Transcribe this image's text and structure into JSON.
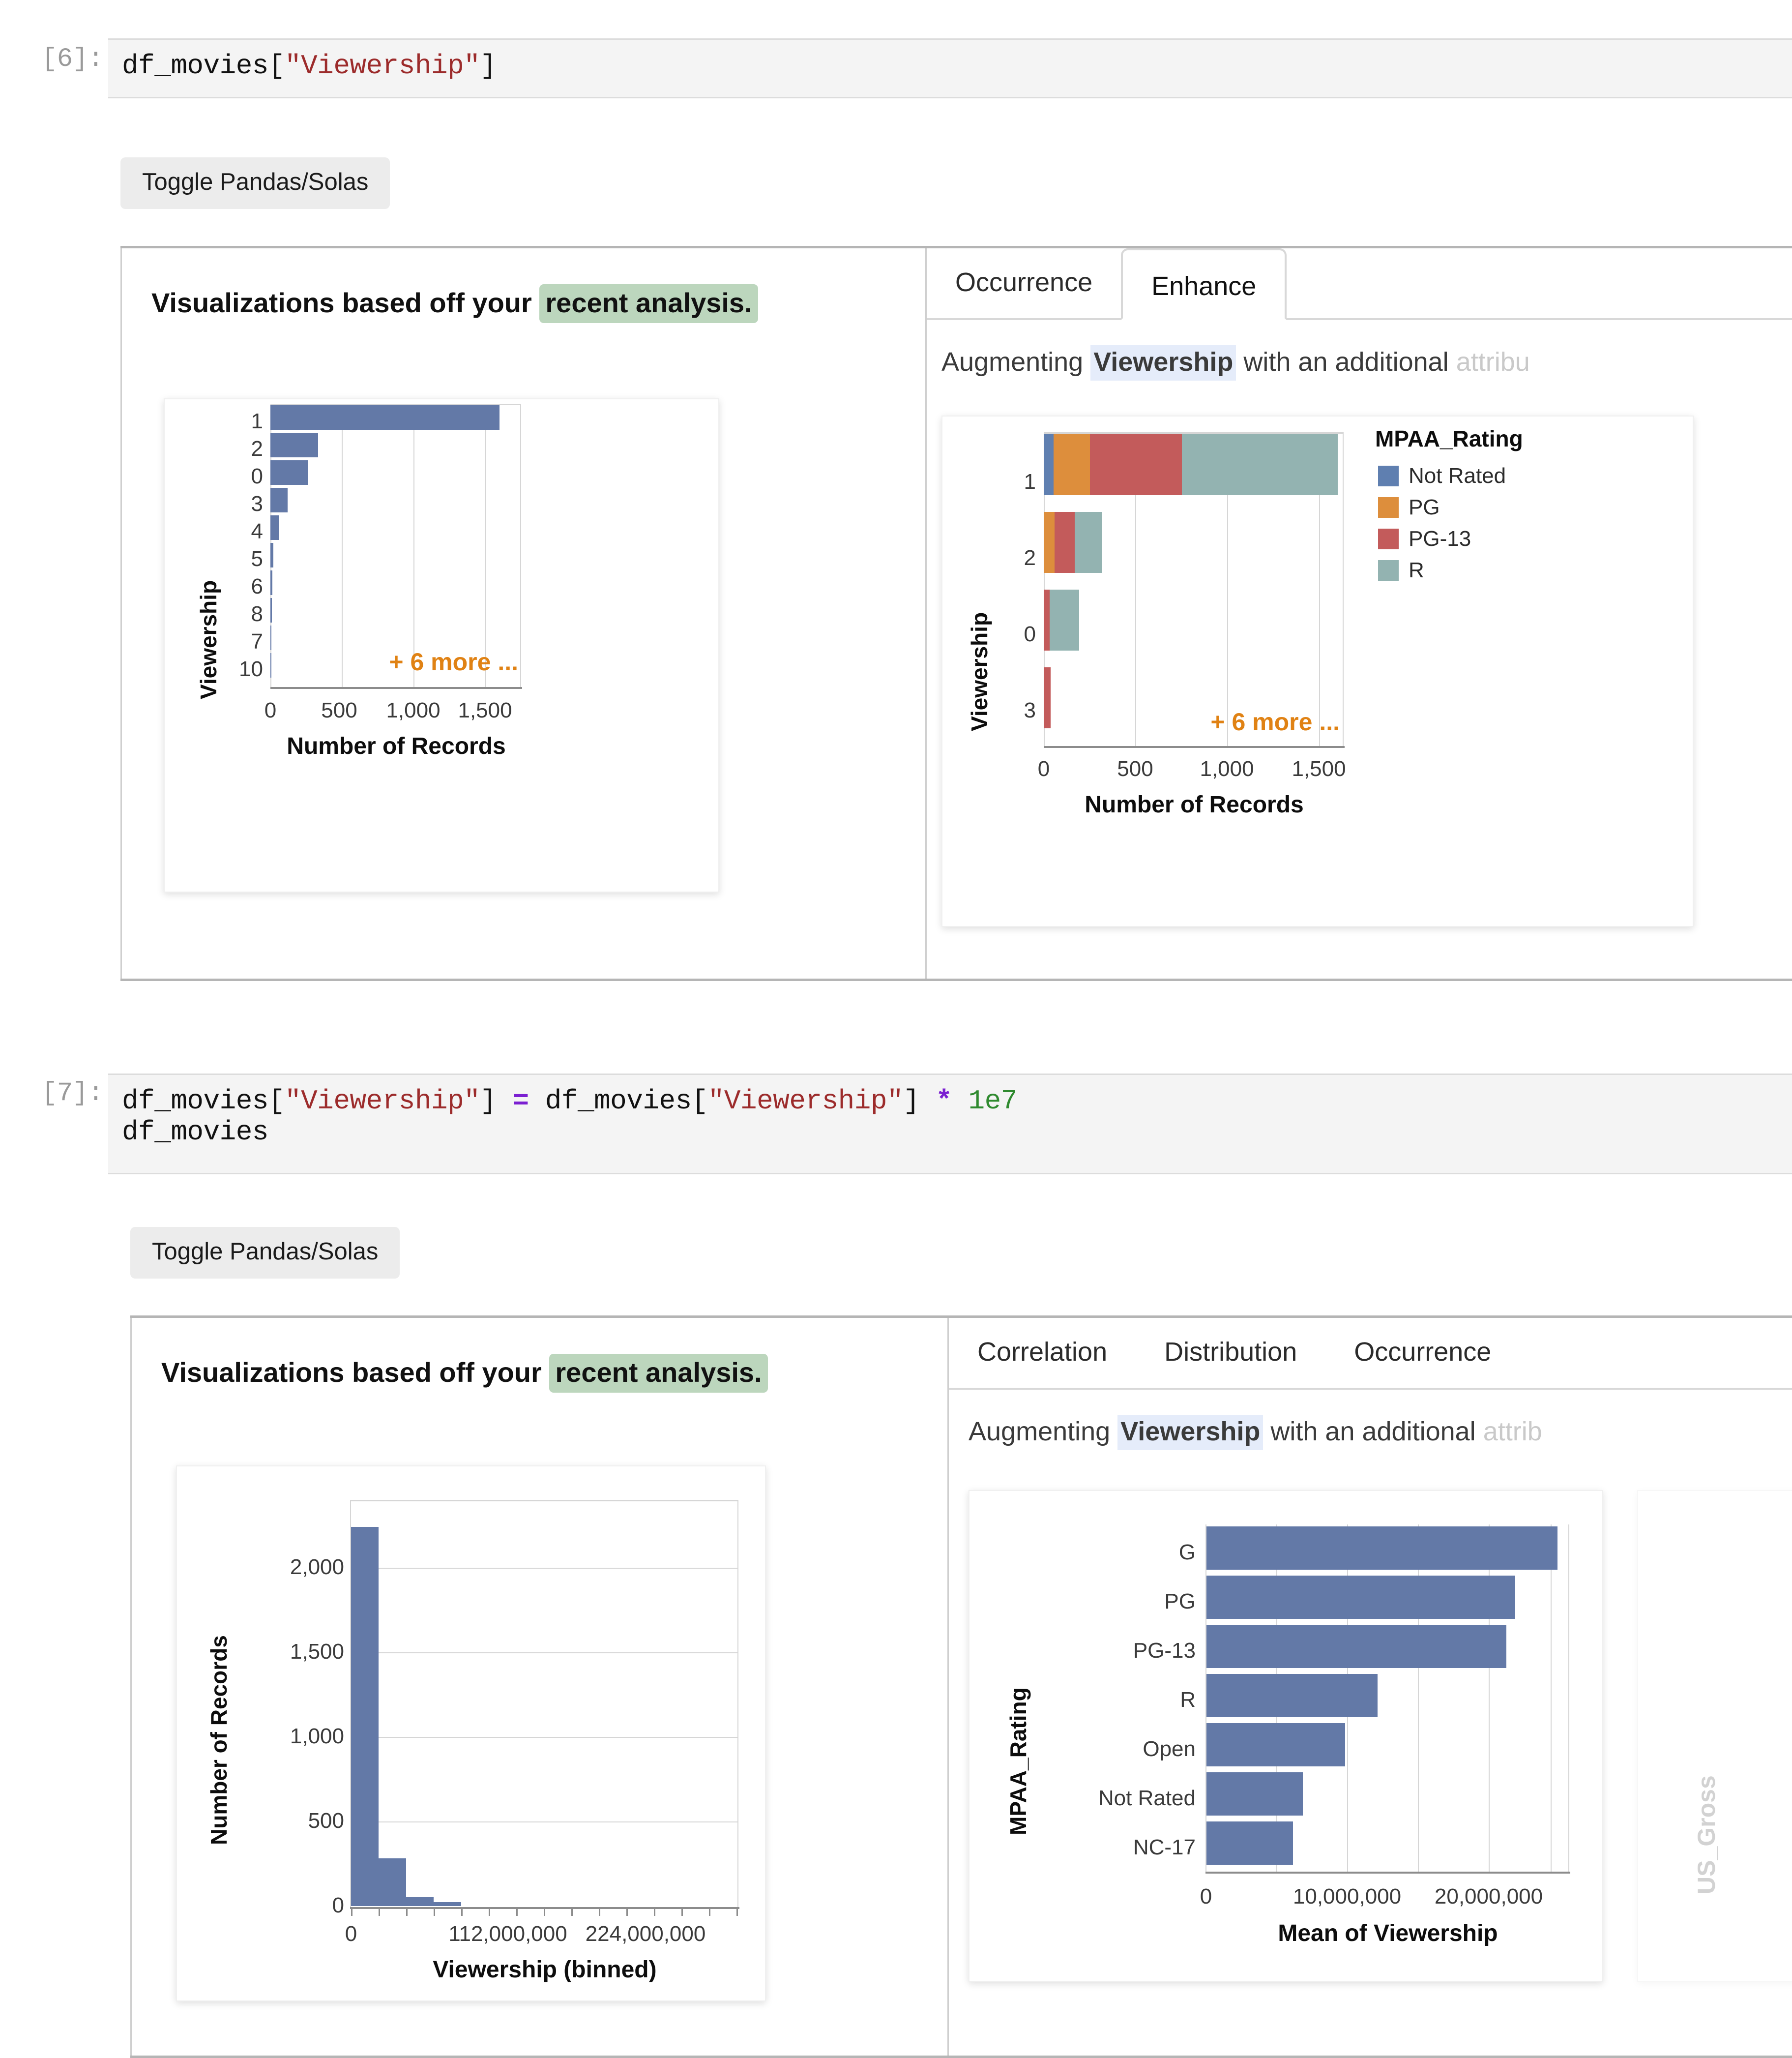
{
  "theme": {
    "bar_blue": "#6379a7",
    "legend_colors": [
      "#5f7fb0",
      "#dd8e3c",
      "#c35b5b",
      "#93b3b1"
    ],
    "accent_orange": "#e08214",
    "highlight_green": "#bcd6bd",
    "highlight_blue": "#e5ecfa",
    "code_bg": "#f4f4f4"
  },
  "cells": [
    {
      "prompt": "[6]:",
      "code_lines": [
        [
          {
            "t": "df_movies[",
            "c": "plain"
          },
          {
            "t": "\"Viewership\"",
            "c": "str"
          },
          {
            "t": "]",
            "c": "plain"
          }
        ]
      ],
      "toggle_label": "Toggle Pandas/Solas",
      "left_panel": {
        "heading_prefix": "Visualizations based off your",
        "heading_highlight": "recent analysis."
      },
      "right_panel": {
        "tabs": [
          {
            "label": "Occurrence",
            "active": false
          },
          {
            "label": "Enhance",
            "active": true
          }
        ],
        "augment_prefix": "Augmenting",
        "augment_attr": "Viewership",
        "augment_mid": "with an additional",
        "augment_tail": "attribu"
      }
    },
    {
      "prompt": "[7]:",
      "code_lines": [
        [
          {
            "t": "df_movies[",
            "c": "plain"
          },
          {
            "t": "\"Viewership\"",
            "c": "str"
          },
          {
            "t": "] ",
            "c": "plain"
          },
          {
            "t": "=",
            "c": "op"
          },
          {
            "t": " df_movies[",
            "c": "plain"
          },
          {
            "t": "\"Viewership\"",
            "c": "str"
          },
          {
            "t": "] ",
            "c": "plain"
          },
          {
            "t": "*",
            "c": "op"
          },
          {
            "t": " ",
            "c": "plain"
          },
          {
            "t": "1e7",
            "c": "num"
          }
        ],
        [
          {
            "t": "df_movies",
            "c": "plain"
          }
        ]
      ],
      "toggle_label": "Toggle Pandas/Solas",
      "left_panel": {
        "heading_prefix": "Visualizations based off your",
        "heading_highlight": "recent analysis."
      },
      "right_panel": {
        "tabs": [
          {
            "label": "Correlation",
            "active": false
          },
          {
            "label": "Distribution",
            "active": false
          },
          {
            "label": "Occurrence",
            "active": false
          }
        ],
        "augment_prefix": "Augmenting",
        "augment_attr": "Viewership",
        "augment_mid": "with an additional",
        "augment_tail": "attrib",
        "ghost_card_label": "US_Gross"
      }
    }
  ],
  "chart_data": [
    {
      "id": "cell6-occurrence-bar",
      "type": "bar",
      "orientation": "horizontal",
      "title": "",
      "xlabel": "Number of Records",
      "ylabel": "Viewership",
      "categories": [
        "1",
        "2",
        "0",
        "3",
        "4",
        "5",
        "6",
        "8",
        "7",
        "10"
      ],
      "values": [
        1600,
        335,
        262,
        120,
        62,
        20,
        9,
        6,
        4,
        2
      ],
      "xlim": [
        0,
        1750
      ],
      "xticks": [
        0,
        500,
        1000,
        1500
      ],
      "xticklabels": [
        "0",
        "500",
        "1,000",
        "1,500"
      ],
      "grid": true,
      "annotation": "+ 6 more ..."
    },
    {
      "id": "cell6-enhance-stacked-bar",
      "type": "bar",
      "orientation": "horizontal",
      "stacked": true,
      "title": "",
      "xlabel": "Number of Records",
      "ylabel": "Viewership",
      "legend_title": "MPAA_Rating",
      "legend_position": "right",
      "categories": [
        "1",
        "2",
        "0",
        "3"
      ],
      "series": [
        {
          "name": "Not Rated",
          "color": "#5f7fb0",
          "values": [
            52,
            0,
            0,
            0
          ]
        },
        {
          "name": "PG",
          "color": "#dd8e3c",
          "values": [
            200,
            58,
            0,
            0
          ]
        },
        {
          "name": "PG-13",
          "color": "#c35b5b",
          "values": [
            500,
            110,
            32,
            39
          ]
        },
        {
          "name": "R",
          "color": "#93b3b1",
          "values": [
            848,
            150,
            160,
            0
          ]
        }
      ],
      "xlim": [
        0,
        1600
      ],
      "xticks": [
        0,
        500,
        1000,
        1500
      ],
      "xticklabels": [
        "0",
        "500",
        "1,000",
        "1,500"
      ],
      "grid": true,
      "annotation": "+ 6 more ..."
    },
    {
      "id": "cell7-distribution-histogram",
      "type": "bar",
      "orientation": "vertical",
      "title": "",
      "xlabel": "Viewership (binned)",
      "ylabel": "Number of Records",
      "bin_starts": [
        0,
        28000000,
        56000000,
        84000000,
        112000000,
        140000000,
        168000000,
        196000000,
        224000000,
        252000000
      ],
      "values": [
        2240,
        280,
        52,
        24,
        0,
        0,
        0,
        0,
        0,
        0
      ],
      "ylim": [
        0,
        2400
      ],
      "yticks": [
        0,
        500,
        1000,
        1500,
        2000
      ],
      "yticklabels": [
        "0",
        "500",
        "1,000",
        "1,500",
        "2,000"
      ],
      "xticks": [
        0,
        112000000,
        224000000
      ],
      "xticklabels": [
        "0",
        "112,000,000",
        "224,000,000"
      ],
      "grid": true
    },
    {
      "id": "cell7-enhance-mean-bar",
      "type": "bar",
      "orientation": "horizontal",
      "title": "",
      "xlabel": "Mean of Viewership",
      "ylabel": "MPAA_Rating",
      "categories": [
        "G",
        "PG",
        "PG-13",
        "R",
        "Open",
        "Not Rated",
        "NC-17"
      ],
      "values": [
        24800000,
        21800000,
        21200000,
        12100000,
        9800000,
        6800000,
        6100000
      ],
      "xlim": [
        0,
        26500000
      ],
      "xticks": [
        0,
        10000000,
        20000000
      ],
      "xticklabels": [
        "0",
        "10,000,000",
        "20,000,000"
      ],
      "grid": true
    }
  ]
}
